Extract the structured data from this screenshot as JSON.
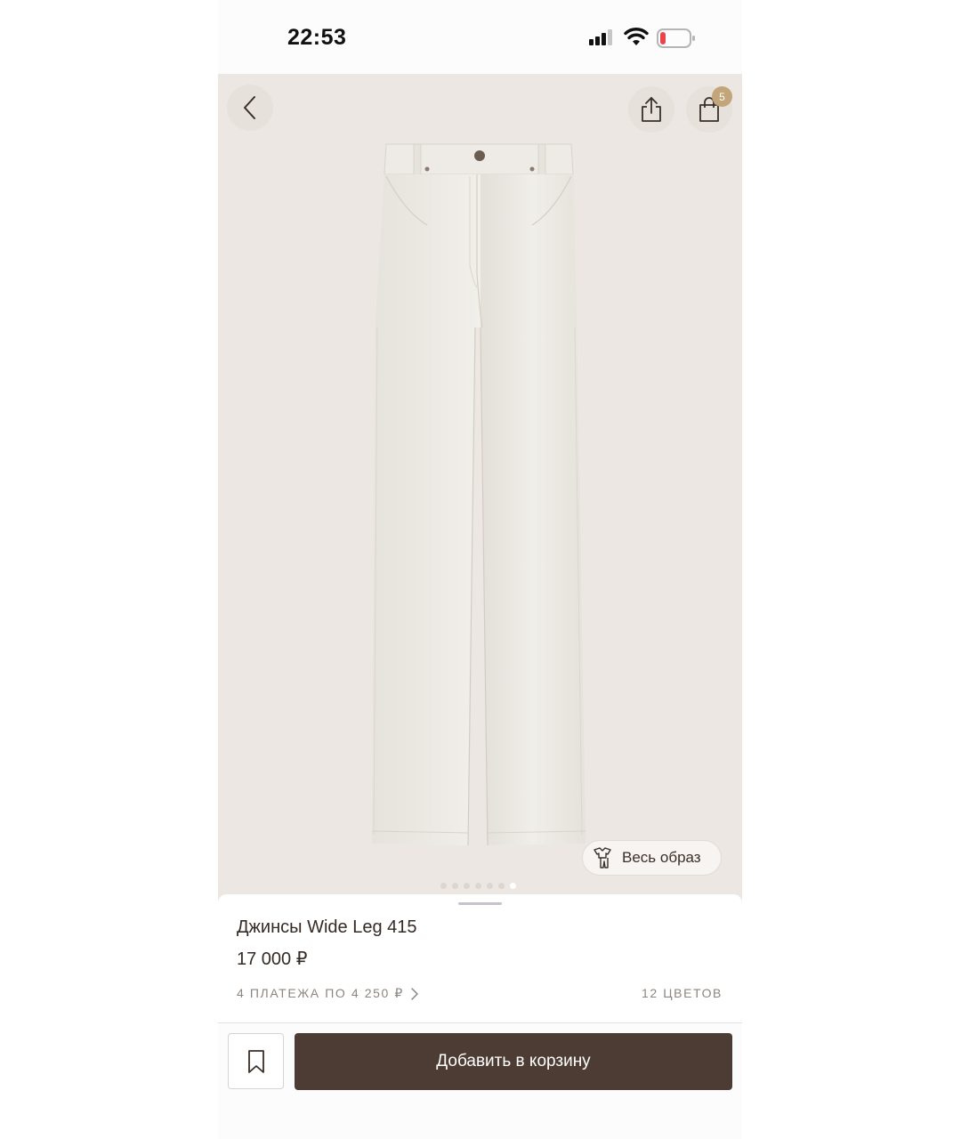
{
  "status_bar": {
    "time": "22:53",
    "battery_color": "#e8454a"
  },
  "header": {
    "cart_count": "5",
    "badge_color": "#c2a67a",
    "icons": {
      "back": "chevron-left-icon",
      "share": "share-icon",
      "bag": "shopping-bag-icon"
    }
  },
  "gallery": {
    "image": "white wide-leg jeans",
    "background_color": "#ece7e2",
    "look_button_label": "Весь образ",
    "look_icon": "outfit-icon",
    "slide_count": 7,
    "active_slide": 7
  },
  "product": {
    "title": "Джинсы Wide Leg 415",
    "price": "17 000 ₽",
    "installments": "4 ПЛАТЕЖА ПО 4 250 ₽",
    "colors": "12 ЦВЕТОВ"
  },
  "actions": {
    "add_to_cart": "Добавить в корзину",
    "bookmark_icon": "bookmark-icon",
    "primary_color": "#4d3c33"
  }
}
